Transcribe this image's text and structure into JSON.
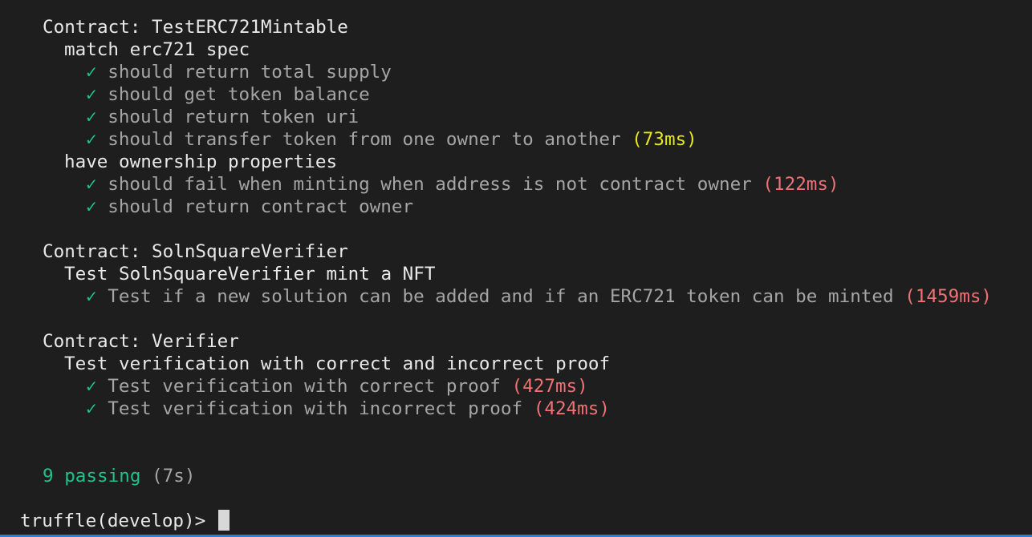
{
  "suites": [
    {
      "contract": "Contract: TestERC721Mintable",
      "groups": [
        {
          "title": "match erc721 spec",
          "tests": [
            {
              "mark": "✓",
              "text": "should return total supply",
              "duration": ""
            },
            {
              "mark": "✓",
              "text": "should get token balance",
              "duration": ""
            },
            {
              "mark": "✓",
              "text": "should return token uri",
              "duration": ""
            },
            {
              "mark": "✓",
              "text": "should transfer token from one owner to another",
              "duration": "(73ms)",
              "duration_color": "#e6e620"
            }
          ]
        },
        {
          "title": "have ownership properties",
          "tests": [
            {
              "mark": "✓",
              "text": "should fail when minting when address is not contract owner",
              "duration": "(122ms)",
              "duration_color": "#f07173"
            },
            {
              "mark": "✓",
              "text": "should return contract owner",
              "duration": ""
            }
          ]
        }
      ]
    },
    {
      "contract": "Contract: SolnSquareVerifier",
      "groups": [
        {
          "title": "Test SolnSquareVerifier mint a NFT",
          "tests": [
            {
              "mark": "✓",
              "text": "Test if a new solution can be added and if an ERC721 token can be minted",
              "duration": "(1459ms)",
              "duration_color": "#f07173"
            }
          ]
        }
      ]
    },
    {
      "contract": "Contract: Verifier",
      "groups": [
        {
          "title": "Test verification with correct and incorrect proof",
          "tests": [
            {
              "mark": "✓",
              "text": "Test verification with correct proof",
              "duration": "(427ms)",
              "duration_color": "#f07173"
            },
            {
              "mark": "✓",
              "text": "Test verification with incorrect proof",
              "duration": "(424ms)",
              "duration_color": "#f07173"
            }
          ]
        }
      ]
    }
  ],
  "summary": {
    "passing": "9 passing",
    "time": "(7s)"
  },
  "prompt": {
    "text": "truffle(develop)>"
  },
  "colors": {
    "background": "#1e1e1e",
    "text": "#e8e8e8",
    "muted_text": "#a5a5a5",
    "check": "#20c08a",
    "slow": "#e6e620",
    "very_slow": "#f07173",
    "border_accent": "#2f7fd0"
  }
}
